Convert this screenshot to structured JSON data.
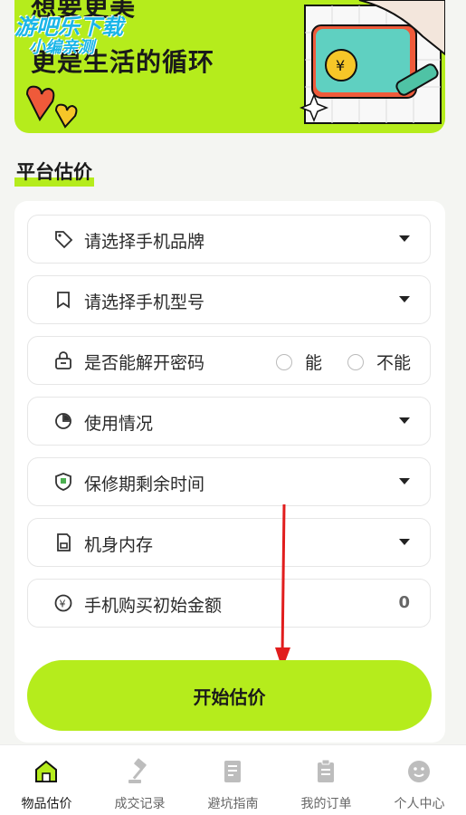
{
  "banner": {
    "line1": "想要更美",
    "line2": "更是生活的循环",
    "watermark_line1": "游吧乐下载",
    "watermark_line2": "小编亲测"
  },
  "section_title": "平台估价",
  "form": {
    "brand": {
      "label": "请选择手机品牌",
      "icon": "tag-icon"
    },
    "model": {
      "label": "请选择手机型号",
      "icon": "bookmark-icon"
    },
    "unlock": {
      "label": "是否能解开密码",
      "icon": "lock-icon",
      "option_yes": "能",
      "option_no": "不能"
    },
    "usage": {
      "label": "使用情况",
      "icon": "pie-chart-icon"
    },
    "warranty": {
      "label": "保修期剩余时间",
      "icon": "shield-icon"
    },
    "storage": {
      "label": "机身内存",
      "icon": "phone-storage-icon"
    },
    "price": {
      "label": "手机购买初始金额",
      "icon": "yen-icon",
      "value": "0"
    }
  },
  "start_button": "开始估价",
  "colors": {
    "accent": "#b5ec1c",
    "arrow": "#e11d1d"
  },
  "nav": [
    {
      "label": "物品估价",
      "icon": "home-icon",
      "active": true
    },
    {
      "label": "成交记录",
      "icon": "gavel-icon",
      "active": false
    },
    {
      "label": "避坑指南",
      "icon": "book-icon",
      "active": false
    },
    {
      "label": "我的订单",
      "icon": "clipboard-icon",
      "active": false
    },
    {
      "label": "个人中心",
      "icon": "smiley-icon",
      "active": false
    }
  ]
}
